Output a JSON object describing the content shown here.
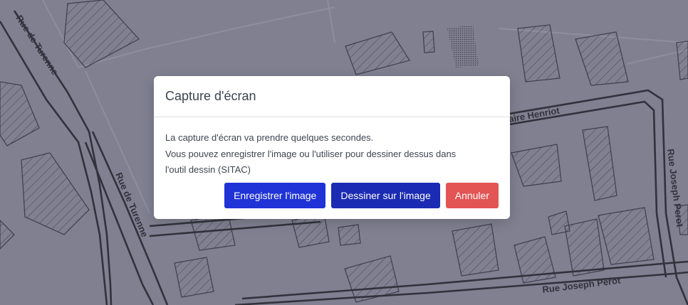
{
  "map": {
    "streets": {
      "turenne_top": "Rue de Turenne",
      "turenne_bottom": "Rue de Turenne",
      "henriot": "aire Henriot",
      "perot_vertical": "Rue Joseph Perot",
      "perot_horizontal": "Rue Joseph Perot"
    }
  },
  "modal": {
    "title": "Capture d'écran",
    "line1": "La capture d'écran va prendre quelques secondes.",
    "line2": "Vous pouvez enregistrer l'image ou l'utiliser pour dessiner dessus dans",
    "line3": "l'outil dessin (SITAC)",
    "buttons": {
      "save": "Enregistrer l'image",
      "draw": "Dessiner sur l'image",
      "cancel": "Annuler"
    }
  },
  "colors": {
    "primary": "#1f33d6",
    "secondary": "#1b2bb3",
    "danger": "#e35454",
    "overlay": "#8b8c98"
  }
}
